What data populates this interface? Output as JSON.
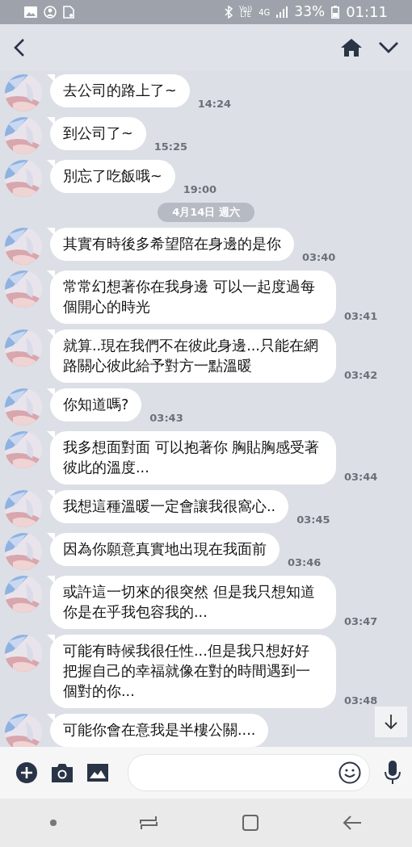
{
  "status_bar": {
    "vo_lte": "Vo))\nLTE",
    "network": "4G",
    "battery": "33%",
    "time": "01:11"
  },
  "messages": [
    {
      "kind": "message",
      "text": "去公司的路上了~",
      "time": "14:24"
    },
    {
      "kind": "message",
      "text": "到公司了~",
      "time": "15:25"
    },
    {
      "kind": "message",
      "text": "別忘了吃飯哦~",
      "time": "19:00"
    },
    {
      "kind": "date",
      "text": "4月14日 週六"
    },
    {
      "kind": "message",
      "text": "其實有時後多希望陪在身邊的是你",
      "time": "03:40"
    },
    {
      "kind": "message",
      "text": "常常幻想著你在我身邊 可以一起度過每個開心的時光",
      "time": "03:41"
    },
    {
      "kind": "message",
      "text": "就算..現在我們不在彼此身邊...只能在網路關心彼此給予對方一點溫暖",
      "time": "03:42"
    },
    {
      "kind": "message",
      "text": "你知道嗎?",
      "time": "03:43"
    },
    {
      "kind": "message",
      "text": "我多想面對面 可以抱著你 胸貼胸感受著彼此的溫度...",
      "time": "03:44"
    },
    {
      "kind": "message",
      "text": "我想這種溫暖一定會讓我很窩心..",
      "time": "03:45"
    },
    {
      "kind": "message",
      "text": "因為你願意真實地出現在我面前",
      "time": "03:46"
    },
    {
      "kind": "message",
      "text": "或許這一切來的很突然  但是我只想知道你是在乎我包容我的...",
      "time": "03:47"
    },
    {
      "kind": "message",
      "text": "可能有時候我很任性...但是我只想好好把握自己的幸福就像在對的時間遇到一個對的你...",
      "time": "03:48"
    },
    {
      "kind": "message",
      "text": "可能你會在意我是半樓公關...."
    }
  ]
}
